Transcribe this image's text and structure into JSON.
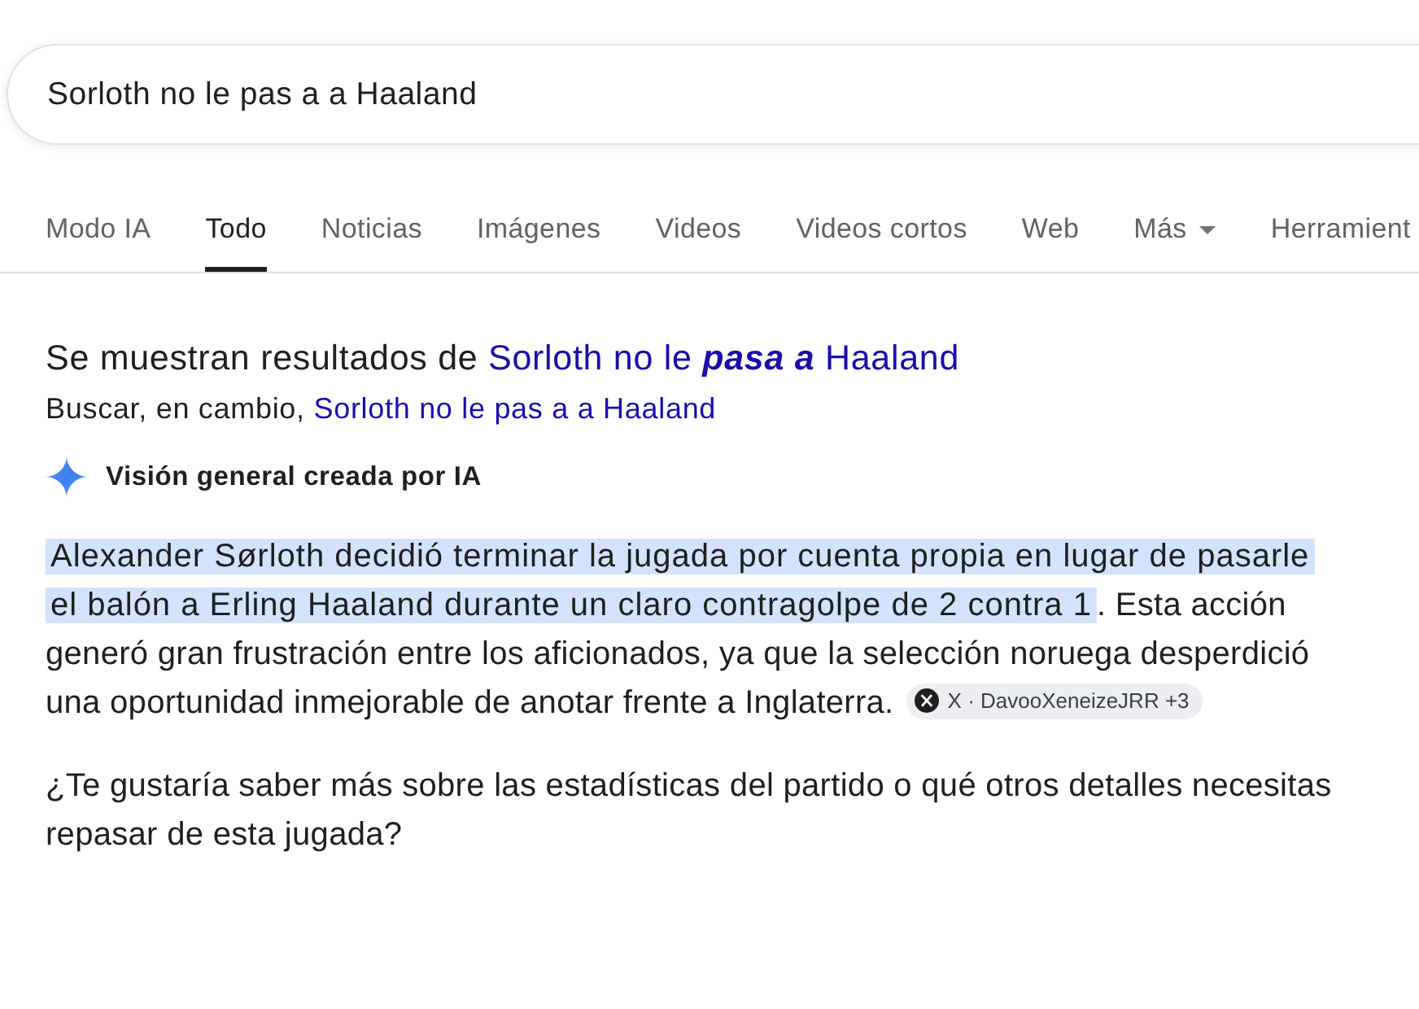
{
  "search": {
    "value": "Sorloth no le pas a a Haaland"
  },
  "tabs": [
    {
      "label": "Modo IA",
      "kind": "tab",
      "selected": false
    },
    {
      "label": "Todo",
      "kind": "tab",
      "selected": true
    },
    {
      "label": "Noticias",
      "kind": "tab",
      "selected": false
    },
    {
      "label": "Imágenes",
      "kind": "tab",
      "selected": false
    },
    {
      "label": "Videos",
      "kind": "tab",
      "selected": false
    },
    {
      "label": "Videos cortos",
      "kind": "tab",
      "selected": false
    },
    {
      "label": "Web",
      "kind": "tab",
      "selected": false
    },
    {
      "label": "Más",
      "kind": "menu",
      "selected": false
    },
    {
      "label": "Herramient",
      "kind": "tab",
      "selected": false
    }
  ],
  "spelling": {
    "showing_prefix": "Se muestran resultados de",
    "showing_link": "Sorloth no le **pasa a** Haaland",
    "instead_prefix": "Buscar, en cambio,",
    "instead_link": "Sorloth no le pas a a Haaland"
  },
  "ai_overview": {
    "title": "Visión general creada por IA",
    "paragraphs": [
      {
        "segments": [
          {
            "text": "Alexander Sørloth decidió terminar la jugada por cuenta propia en lugar de pasarle el balón a Erling Haaland durante un claro contragolpe de 2 contra 1",
            "highlighted": true
          },
          {
            "text": ". Esta acción generó gran frustración entre los aficionados, ya que la selección noruega desperdició una oportunidad inmejorable de anotar frente a Inglaterra.",
            "highlighted": false
          }
        ],
        "source": {
          "label": "X · DavooXeneizeJRR +3"
        }
      },
      {
        "segments": [
          {
            "text": "¿Te gustaría saber más sobre las estadísticas del partido o qué otros detalles necesitas repasar de esta jugada?",
            "highlighted": false
          }
        ]
      }
    ]
  }
}
